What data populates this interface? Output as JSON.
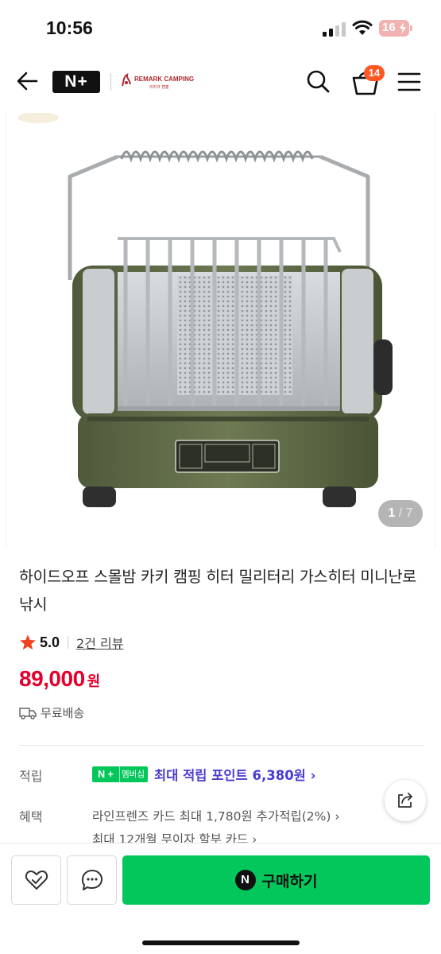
{
  "status_bar": {
    "time": "10:56",
    "battery": "16"
  },
  "header": {
    "nplus_logo": "N+",
    "brand_name": "REMARK CAMPING",
    "brand_sub": "리마크 캠핑",
    "cart_count": "14"
  },
  "gallery": {
    "current": "1",
    "separator": " / ",
    "total": "7"
  },
  "product": {
    "title": "하이드오프 스몰밤 카키 캠핑 히터 밀리터리 가스히터 미니난로 낚시",
    "rating": "5.0",
    "review_link": "2건 리뷰",
    "price": "89,000",
    "price_unit": "원",
    "shipping": "무료배송"
  },
  "benefits": {
    "points_label": "적립",
    "nplus_badge": "N +",
    "membership_tag": "멤버십",
    "points_text": "최대 적립 포인트 6,380원 ›",
    "benefit_label": "혜택",
    "benefit_line1": "라인프렌즈 카드 최대 1,780원 추가적립(2%) ›",
    "benefit_line2": "최대 12개월 무이자 할부 카드 ›"
  },
  "bottom_bar": {
    "npay_icon": "N",
    "buy_label": "구매하기"
  },
  "colors": {
    "accent_green": "#03c75a",
    "price_red": "#e4002b",
    "points_purple": "#4a3bd2",
    "badge_orange": "#ff5722"
  }
}
